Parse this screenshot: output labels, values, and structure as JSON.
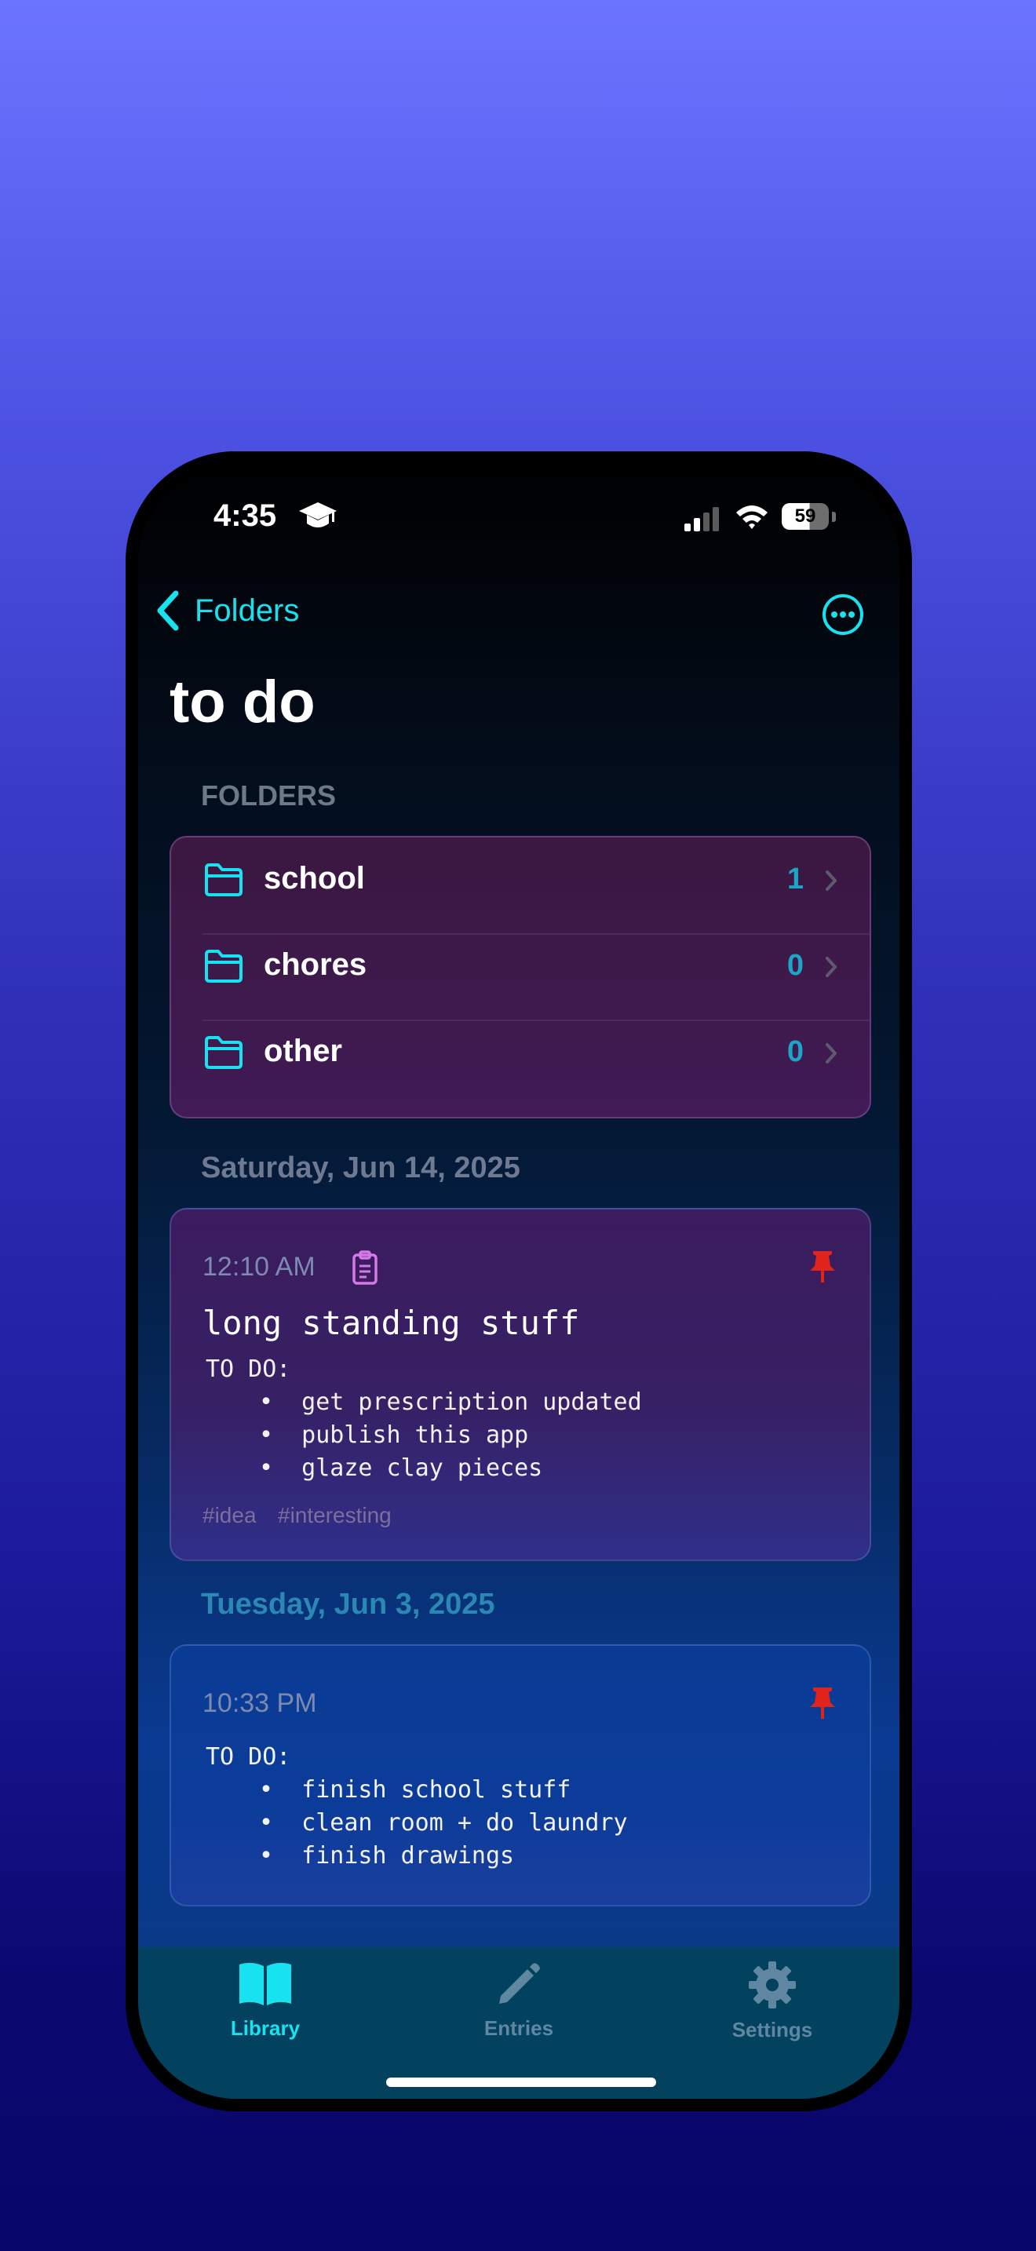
{
  "status": {
    "time": "4:35",
    "battery": "59"
  },
  "nav": {
    "back_label": "Folders"
  },
  "page": {
    "title": "to do"
  },
  "folders": {
    "header": "FOLDERS",
    "items": [
      {
        "name": "school",
        "count": "1"
      },
      {
        "name": "chores",
        "count": "0"
      },
      {
        "name": "other",
        "count": "0"
      }
    ]
  },
  "entries": [
    {
      "date": "Saturday, Jun 14, 2025",
      "time": "12:10 AM",
      "title": "long standing stuff",
      "heading": "TO DO:",
      "bullets": [
        "•  get prescription updated",
        "•  publish this app",
        "•  glaze clay pieces"
      ],
      "tags": [
        "#idea",
        "#interesting"
      ]
    },
    {
      "date": "Tuesday, Jun 3, 2025",
      "time": "10:33 PM",
      "heading": "TO DO:",
      "bullets": [
        "•  finish school stuff",
        "•  clean room + do laundry",
        "•  finish drawings"
      ]
    }
  ],
  "tabs": [
    {
      "label": "Library",
      "icon": "book-open-icon",
      "active": true
    },
    {
      "label": "Entries",
      "icon": "pencil-icon",
      "active": false
    },
    {
      "label": "Settings",
      "icon": "gear-icon",
      "active": false
    }
  ],
  "colors": {
    "accent": "#18e1f0",
    "pin": "#e0241c",
    "folder_count": "#1ea4c4"
  }
}
